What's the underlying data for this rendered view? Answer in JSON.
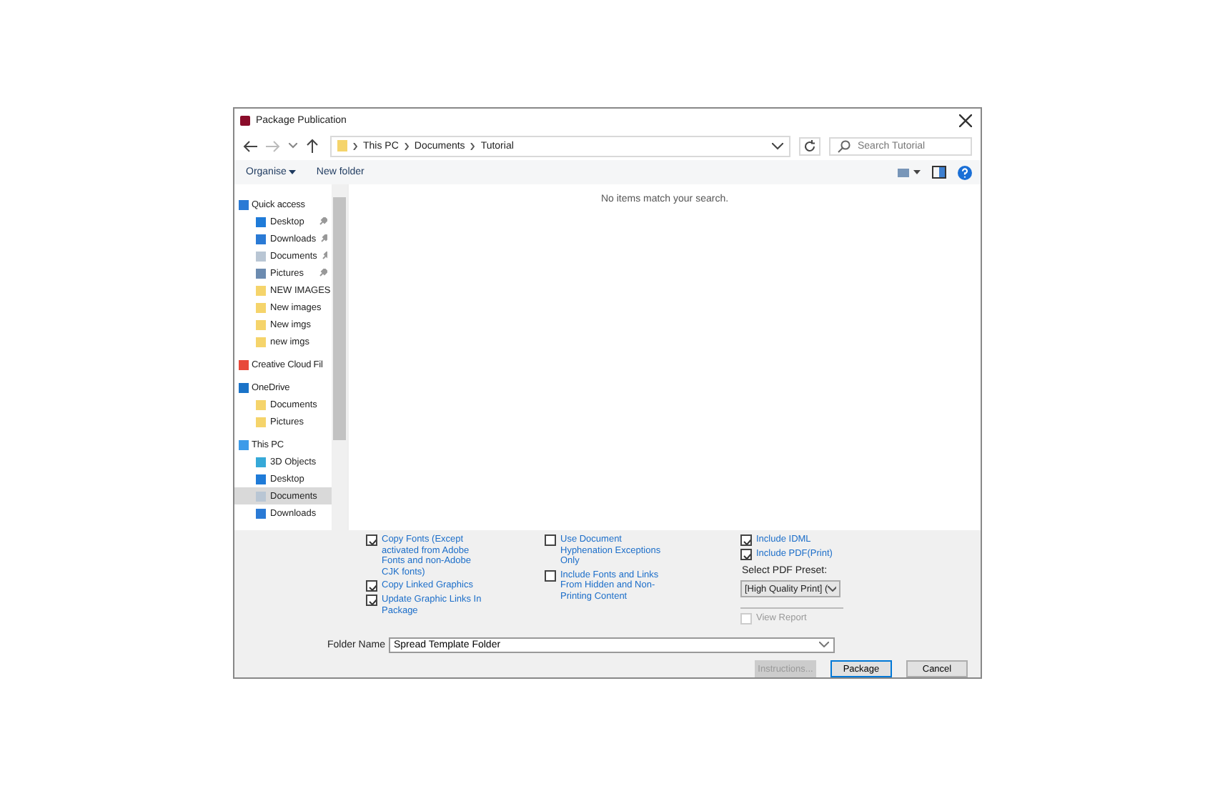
{
  "window": {
    "title": "Package Publication"
  },
  "address": {
    "crumbs": [
      "This PC",
      "Documents",
      "Tutorial"
    ],
    "search_placeholder": "Search Tutorial"
  },
  "toolbar": {
    "organise": "Organise",
    "new_folder": "New folder"
  },
  "sidebar": {
    "items": [
      {
        "label": "Quick access",
        "kind": "star",
        "selected": false,
        "children": [
          {
            "label": "Desktop",
            "kind": "desktop",
            "pinned": true,
            "selected": false
          },
          {
            "label": "Downloads",
            "kind": "download",
            "pinned": true,
            "selected": false
          },
          {
            "label": "Documents",
            "kind": "document",
            "pinned": true,
            "selected": false
          },
          {
            "label": "Pictures",
            "kind": "picture",
            "pinned": true,
            "selected": false
          },
          {
            "label": "NEW IMAGES",
            "kind": "folder",
            "pinned": false,
            "selected": false
          },
          {
            "label": "New images",
            "kind": "folder",
            "pinned": false,
            "selected": false
          },
          {
            "label": "New imgs",
            "kind": "folder",
            "pinned": false,
            "selected": false
          },
          {
            "label": "new imgs",
            "kind": "folder",
            "pinned": false,
            "selected": false
          }
        ]
      },
      {
        "label": "Creative Cloud Fil",
        "kind": "cc",
        "selected": false
      },
      {
        "label": "OneDrive",
        "kind": "cloud",
        "selected": false,
        "children": [
          {
            "label": "Documents",
            "kind": "folder",
            "pinned": false,
            "selected": false
          },
          {
            "label": "Pictures",
            "kind": "folder",
            "pinned": false,
            "selected": false
          }
        ]
      },
      {
        "label": "This PC",
        "kind": "pc",
        "selected": false,
        "children": [
          {
            "label": "3D Objects",
            "kind": "cube",
            "pinned": false,
            "selected": false
          },
          {
            "label": "Desktop",
            "kind": "desktop",
            "pinned": false,
            "selected": false
          },
          {
            "label": "Documents",
            "kind": "document",
            "pinned": false,
            "selected": true
          },
          {
            "label": "Downloads",
            "kind": "download",
            "pinned": false,
            "selected": false
          }
        ]
      }
    ]
  },
  "empty_message": "No items match your search.",
  "options": [
    [
      {
        "label": "Copy Fonts (Except activated from Adobe Fonts and non-Adobe CJK fonts)",
        "checked": true
      },
      {
        "label": "Copy Linked Graphics",
        "checked": true
      },
      {
        "label": "Update Graphic Links In Package",
        "checked": true
      }
    ],
    [
      {
        "label": "Use Document Hyphenation Exceptions Only",
        "checked": false
      },
      {
        "label": "Include Fonts and Links From Hidden and Non-Printing Content",
        "checked": false
      }
    ]
  ],
  "pdf": {
    "include_idml": {
      "label": "Include IDML",
      "checked": true
    },
    "include_pdf": {
      "label": "Include PDF(Print)",
      "checked": true
    },
    "preset_label": "Select PDF Preset:",
    "preset_value": "[High Quality Print] (",
    "view_report": {
      "label": "View Report",
      "checked": false,
      "disabled": true
    }
  },
  "folder_name": {
    "label": "Folder Name",
    "value": "Spread Template Folder"
  },
  "buttons": [
    {
      "label": "Instructions...",
      "disabled": true,
      "default": false
    },
    {
      "label": "Package",
      "disabled": false,
      "default": true
    },
    {
      "label": "Cancel",
      "disabled": false,
      "default": false
    }
  ]
}
